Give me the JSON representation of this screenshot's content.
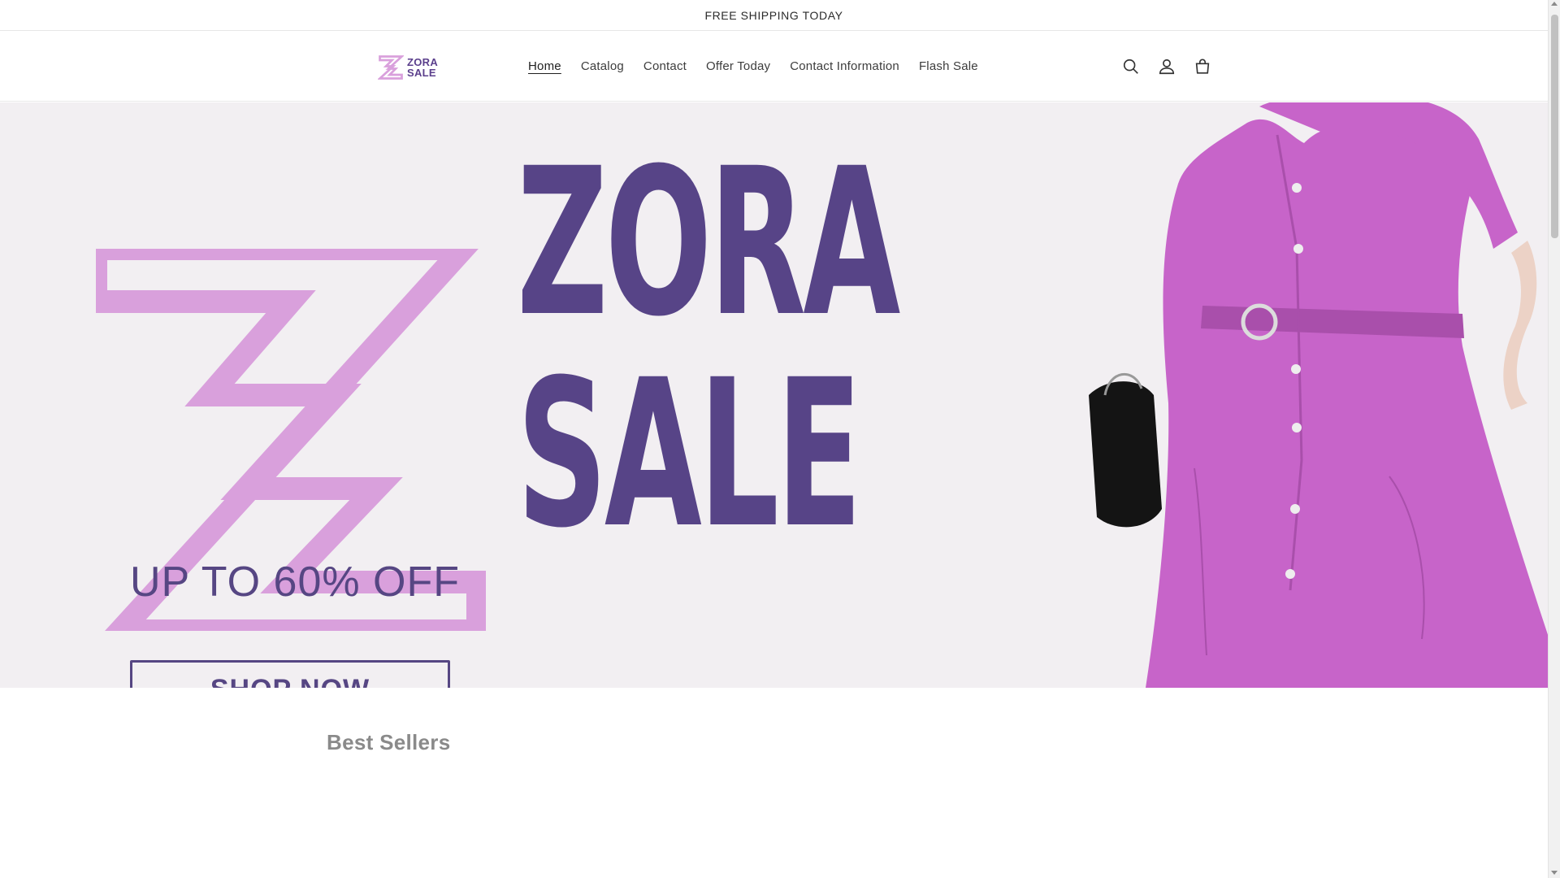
{
  "announcement": {
    "text": "FREE SHIPPING TODAY"
  },
  "header": {
    "logo": {
      "line1": "ZORA",
      "line2": "SALE"
    },
    "nav": [
      {
        "label": "Home",
        "active": true
      },
      {
        "label": "Catalog",
        "active": false
      },
      {
        "label": "Contact",
        "active": false
      },
      {
        "label": "Offer Today",
        "active": false
      },
      {
        "label": "Contact Information",
        "active": false
      },
      {
        "label": "Flash Sale",
        "active": false
      }
    ],
    "icons": [
      "search-icon",
      "account-icon",
      "cart-icon"
    ]
  },
  "hero": {
    "word1": "ZORA",
    "word2": "SALE",
    "offer": "UP TO 60% OFF",
    "button": "SHOP NOW"
  },
  "sections": {
    "best_sellers": "Best Sellers"
  },
  "colors": {
    "brand_purple": "#574487",
    "logo_pink": "#d9a0dc",
    "dress": "#c764c9",
    "hero_bg": "#f2eff2"
  }
}
